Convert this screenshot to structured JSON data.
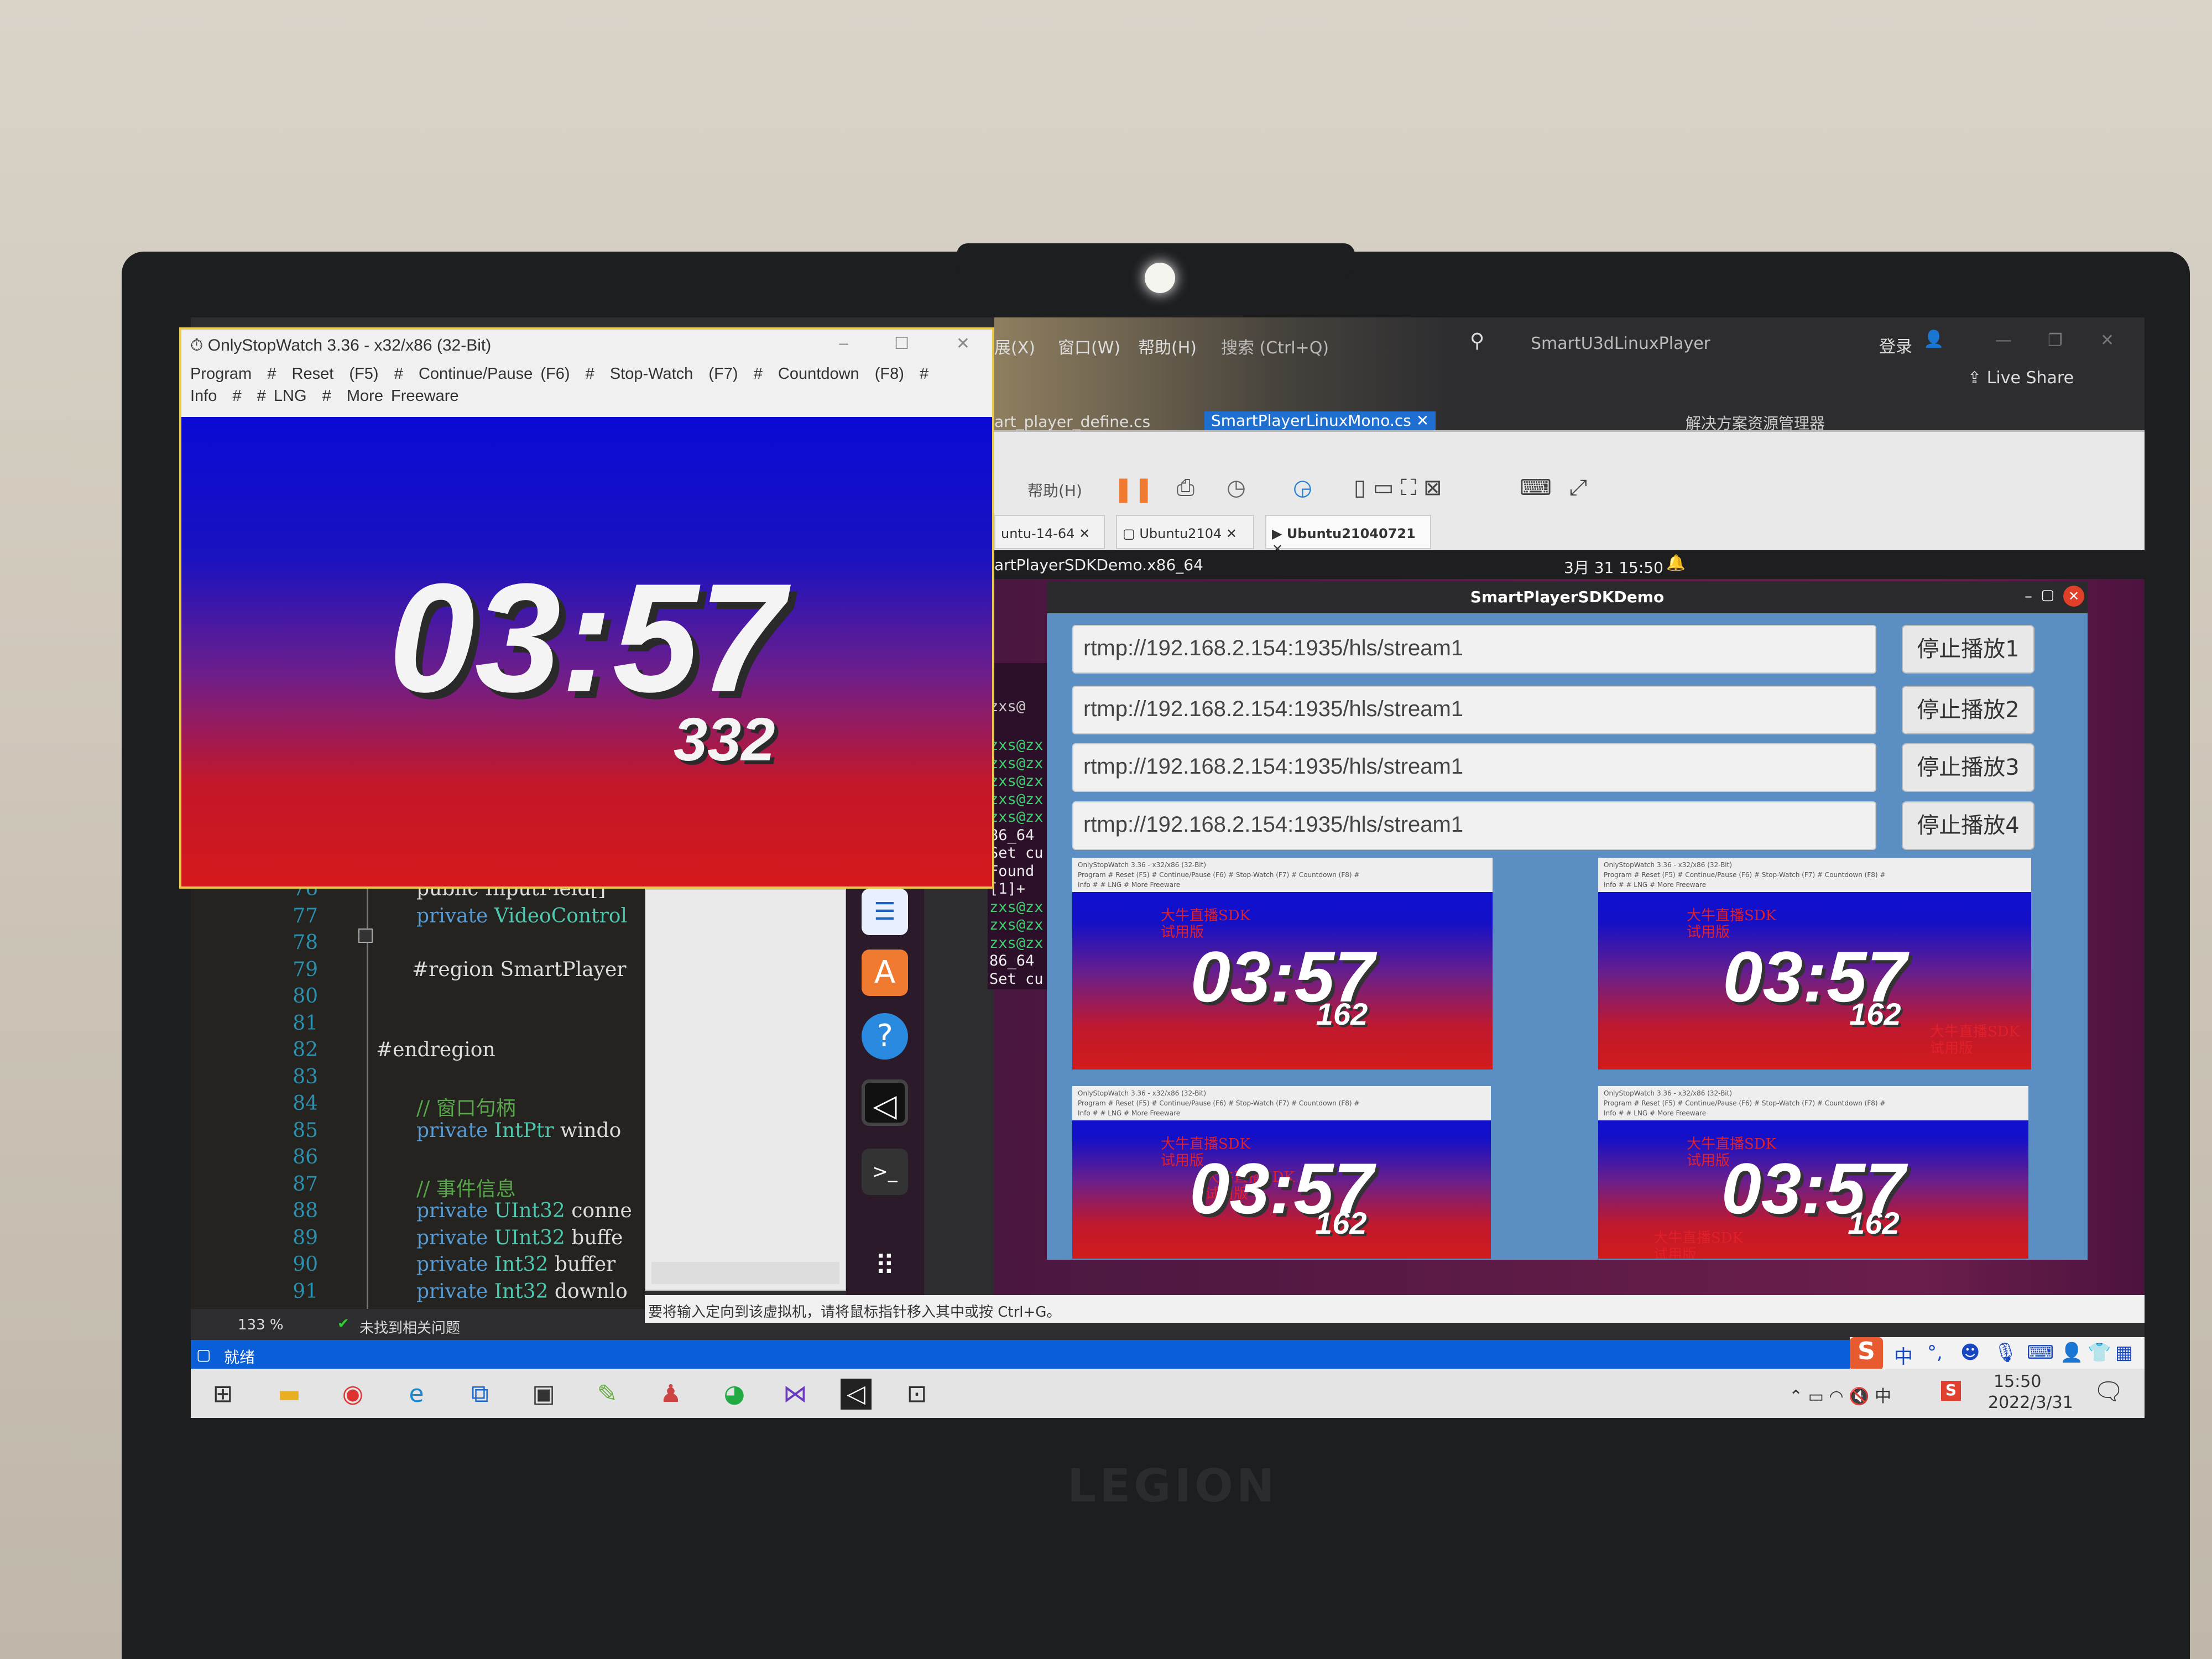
{
  "device": {
    "brand_logo": "LEGION"
  },
  "stopwatch": {
    "title": "OnlyStopWatch 3.36 - x32/x86 (32-Bit)",
    "menu_line1": "Program  #  Reset  (F5)  #  Continue/Pause (F6)  #  Stop-Watch  (F7)  #  Countdown  (F8)  #",
    "menu_line2": "Info  #  # LNG  #  More Freeware",
    "time": "03:57",
    "ms": "332",
    "min": "–",
    "max": "☐",
    "close": "✕"
  },
  "vs": {
    "menu": [
      "展(X)",
      "窗口(W)",
      "帮助(H)"
    ],
    "search": "搜索 (Ctrl+Q)",
    "project": "SmartU3dLinuxPlayer",
    "login": "登录",
    "live_share": "Live Share",
    "tabs": [
      "art_player_define.cs",
      "SmartPlayerLinuxMono.cs"
    ],
    "solution_explorer": "解决方案资源管理器",
    "zoom": "133 %",
    "issues": "未找到相关问题",
    "ready": "就绪",
    "code": [
      {
        "n": "76",
        "t": "public InputField[]"
      },
      {
        "n": "77",
        "kw": "private",
        "ty": "VideoControl",
        "rest": ""
      },
      {
        "n": "78"
      },
      {
        "n": "79",
        "t": "#region SmartPlayer"
      },
      {
        "n": "80"
      },
      {
        "n": "81"
      },
      {
        "n": "82",
        "t": "#endregion"
      },
      {
        "n": "83"
      },
      {
        "n": "84",
        "cm": "// 窗口句柄"
      },
      {
        "n": "85",
        "kw": "private",
        "ty": "IntPtr",
        "rest": " windo"
      },
      {
        "n": "86"
      },
      {
        "n": "87",
        "cm": "// 事件信息"
      },
      {
        "n": "88",
        "kw": "private",
        "ty": "UInt32",
        "rest": " conne"
      },
      {
        "n": "89",
        "kw": "private",
        "ty": "UInt32",
        "rest": " buffe"
      },
      {
        "n": "90",
        "kw": "private",
        "ty": "Int32",
        "rest": " buffer"
      },
      {
        "n": "91",
        "kw": "private",
        "ty": "Int32",
        "rest": " downlo"
      }
    ]
  },
  "vm": {
    "help": "帮助(H)",
    "tabs": [
      "untu-14-64",
      "Ubuntu2104",
      "Ubuntu21040721"
    ],
    "status": "要将输入定向到该虚拟机，请将鼠标指针移入其中或按 Ctrl+G。"
  },
  "ubuntu": {
    "app": "artPlayerSDKDemo.x86_64",
    "clock": "3月 31  15:50"
  },
  "terminal": {
    "tab": "zxs@",
    "lines": [
      "zxs@zx",
      "zxs@zx",
      "zxs@zx",
      "zxs@zx",
      "zxs@zx",
      "86_64",
      "Set cu",
      "Found",
      "[1]+",
      "zxs@zx",
      "zxs@zx",
      "zxs@zx",
      "86_64",
      "Set cu",
      "Found"
    ]
  },
  "demo": {
    "title": "SmartPlayerSDKDemo",
    "urls": [
      "rtmp://192.168.2.154:1935/hls/stream1",
      "rtmp://192.168.2.154:1935/hls/stream1",
      "rtmp://192.168.2.154:1935/hls/stream1",
      "rtmp://192.168.2.154:1935/hls/stream1"
    ],
    "buttons": [
      "停止播放1",
      "停止播放2",
      "停止播放3",
      "停止播放4"
    ],
    "video_header": "OnlyStopWatch 3.36 - x32/x86 (32-Bit)",
    "video_menu1": "Program # Reset (F5) # Continue/Pause (F6) # Stop-Watch (F7) # Countdown (F8) #",
    "video_menu2": "Info # # LNG # More Freeware",
    "watermark1": "大牛直播SDK",
    "watermark2": "试用版",
    "video_time": "03:57",
    "video_ms": "162"
  },
  "tray": {
    "ime": "中",
    "time": "15:50",
    "date": "2022/3/31"
  },
  "colors": {
    "accent_blue": "#0a5fd8",
    "gradient_top": "#0a0ad5",
    "gradient_bottom": "#d4181a",
    "watermark": "#e0202a"
  }
}
